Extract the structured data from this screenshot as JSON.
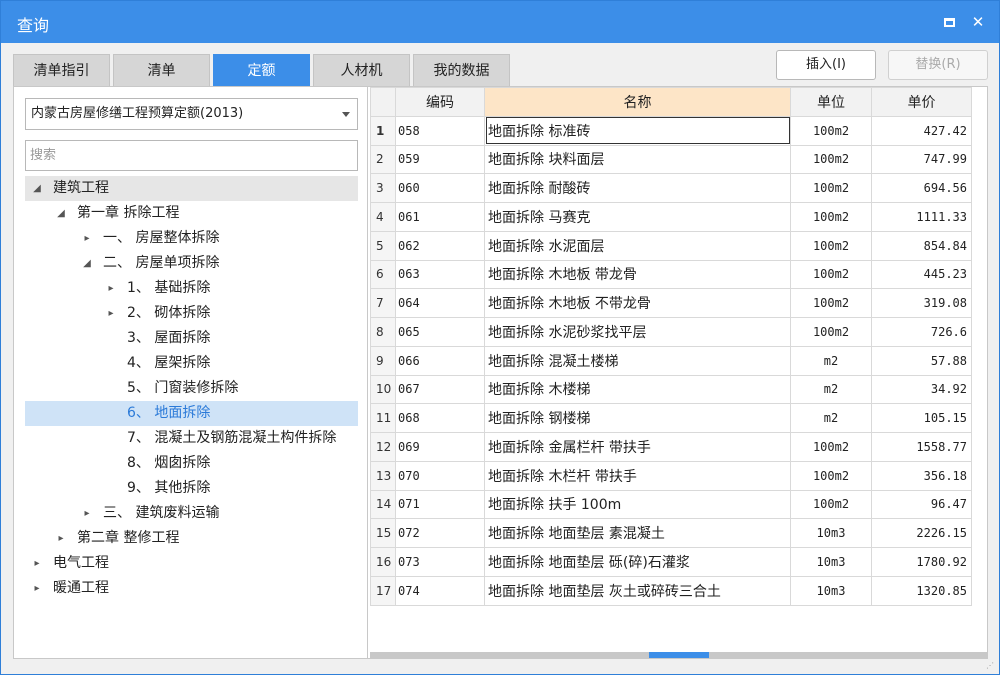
{
  "window": {
    "title": "查询"
  },
  "tabs": [
    "清单指引",
    "清单",
    "定额",
    "人材机",
    "我的数据"
  ],
  "active_tab": 2,
  "buttons": {
    "insert": "插入(I)",
    "replace": "替换(R)"
  },
  "library": {
    "selected": "内蒙古房屋修缮工程预算定额(2013)"
  },
  "search": {
    "placeholder": "搜索",
    "value": ""
  },
  "tree": [
    {
      "label": "建筑工程",
      "level": 0,
      "toggle": "expanded",
      "style": "root"
    },
    {
      "label": "第一章 拆除工程",
      "level": 1,
      "toggle": "expanded"
    },
    {
      "label": "一、  房屋整体拆除",
      "level": 2,
      "toggle": "collapsed"
    },
    {
      "label": "二、  房屋单项拆除",
      "level": 2,
      "toggle": "expanded"
    },
    {
      "label": "1、  基础拆除",
      "level": 3,
      "toggle": "collapsed"
    },
    {
      "label": "2、  砌体拆除",
      "level": 3,
      "toggle": "collapsed"
    },
    {
      "label": "3、  屋面拆除",
      "level": 3,
      "toggle": "none"
    },
    {
      "label": "4、  屋架拆除",
      "level": 3,
      "toggle": "none"
    },
    {
      "label": "5、  门窗装修拆除",
      "level": 3,
      "toggle": "none"
    },
    {
      "label": "6、  地面拆除",
      "level": 3,
      "toggle": "none",
      "style": "selected"
    },
    {
      "label": "7、  混凝土及钢筋混凝土构件拆除",
      "level": 3,
      "toggle": "none"
    },
    {
      "label": "8、  烟囱拆除",
      "level": 3,
      "toggle": "none"
    },
    {
      "label": "9、  其他拆除",
      "level": 3,
      "toggle": "none"
    },
    {
      "label": "三、  建筑废料运输",
      "level": 2,
      "toggle": "collapsed"
    },
    {
      "label": "第二章 整修工程",
      "level": 1,
      "toggle": "collapsed"
    },
    {
      "label": "电气工程",
      "level": 0,
      "toggle": "collapsed"
    },
    {
      "label": "暖通工程",
      "level": 0,
      "toggle": "collapsed"
    }
  ],
  "table": {
    "columns": [
      "编码",
      "名称",
      "单位",
      "单价"
    ],
    "active_column": 1,
    "rows": [
      {
        "n": "1",
        "code": "058",
        "name": "地面拆除 标准砖",
        "unit": "100m2",
        "price": "427.42"
      },
      {
        "n": "2",
        "code": "059",
        "name": "地面拆除 块料面层",
        "unit": "100m2",
        "price": "747.99"
      },
      {
        "n": "3",
        "code": "060",
        "name": "地面拆除 耐酸砖",
        "unit": "100m2",
        "price": "694.56"
      },
      {
        "n": "4",
        "code": "061",
        "name": "地面拆除 马赛克",
        "unit": "100m2",
        "price": "1111.33"
      },
      {
        "n": "5",
        "code": "062",
        "name": "地面拆除 水泥面层",
        "unit": "100m2",
        "price": "854.84"
      },
      {
        "n": "6",
        "code": "063",
        "name": "地面拆除 木地板 带龙骨",
        "unit": "100m2",
        "price": "445.23"
      },
      {
        "n": "7",
        "code": "064",
        "name": "地面拆除 木地板 不带龙骨",
        "unit": "100m2",
        "price": "319.08"
      },
      {
        "n": "8",
        "code": "065",
        "name": "地面拆除 水泥砂浆找平层",
        "unit": "100m2",
        "price": "726.6"
      },
      {
        "n": "9",
        "code": "066",
        "name": "地面拆除 混凝土楼梯",
        "unit": "m2",
        "price": "57.88"
      },
      {
        "n": "10",
        "code": "067",
        "name": "地面拆除 木楼梯",
        "unit": "m2",
        "price": "34.92"
      },
      {
        "n": "11",
        "code": "068",
        "name": "地面拆除 钢楼梯",
        "unit": "m2",
        "price": "105.15"
      },
      {
        "n": "12",
        "code": "069",
        "name": "地面拆除 金属栏杆 带扶手",
        "unit": "100m2",
        "price": "1558.77"
      },
      {
        "n": "13",
        "code": "070",
        "name": "地面拆除 木栏杆 带扶手",
        "unit": "100m2",
        "price": "356.18"
      },
      {
        "n": "14",
        "code": "071",
        "name": "地面拆除 扶手 100m",
        "unit": "100m2",
        "price": "96.47"
      },
      {
        "n": "15",
        "code": "072",
        "name": "地面拆除 地面垫层 素混凝土",
        "unit": "10m3",
        "price": "2226.15"
      },
      {
        "n": "16",
        "code": "073",
        "name": "地面拆除 地面垫层 砾(碎)石灌浆",
        "unit": "10m3",
        "price": "1780.92"
      },
      {
        "n": "17",
        "code": "074",
        "name": "地面拆除 地面垫层 灰土或碎砖三合土",
        "unit": "10m3",
        "price": "1320.85"
      }
    ]
  },
  "icons": {
    "maximize": "maximize-icon",
    "close": "close-icon",
    "dropdown": "chevron-down-icon",
    "tree_expanded": "triangle-down-icon",
    "tree_collapsed": "triangle-right-icon"
  },
  "colors": {
    "accent": "#3c8ee8",
    "selected_bg": "#cfe3f7",
    "active_header": "#fde5c7"
  }
}
